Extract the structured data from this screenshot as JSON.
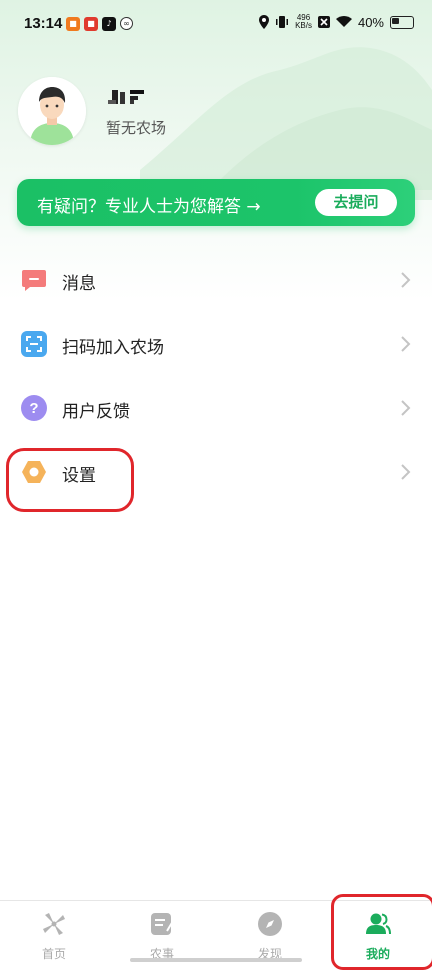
{
  "status_bar": {
    "time": "13:14",
    "speed_value": "496",
    "speed_unit": "KB/s",
    "battery": "40%",
    "notification_icons": [
      "app-icon-orange",
      "app-icon-red",
      "tiktok-icon",
      "link-icon"
    ]
  },
  "profile": {
    "farm_status": "暂无农场"
  },
  "banner": {
    "text": "有疑问？专业人士为您解答 →",
    "button_label": "去提问"
  },
  "menu": {
    "items": [
      {
        "label": "消息",
        "icon": "message-icon",
        "color": "#f47b7b"
      },
      {
        "label": "扫码加入农场",
        "icon": "scan-icon",
        "color": "#4aa8ef"
      },
      {
        "label": "用户反馈",
        "icon": "question-icon",
        "color": "#9d8cf0"
      },
      {
        "label": "设置",
        "icon": "settings-icon",
        "color": "#f5b35a"
      }
    ]
  },
  "tabs": [
    {
      "label": "首页",
      "icon": "windmill-icon",
      "active": false
    },
    {
      "label": "农事",
      "icon": "notes-icon",
      "active": false
    },
    {
      "label": "发现",
      "icon": "compass-icon",
      "active": false
    },
    {
      "label": "我的",
      "icon": "user-group-icon",
      "active": true
    }
  ],
  "colors": {
    "accent": "#1bc065",
    "annotation": "#e0262b"
  }
}
